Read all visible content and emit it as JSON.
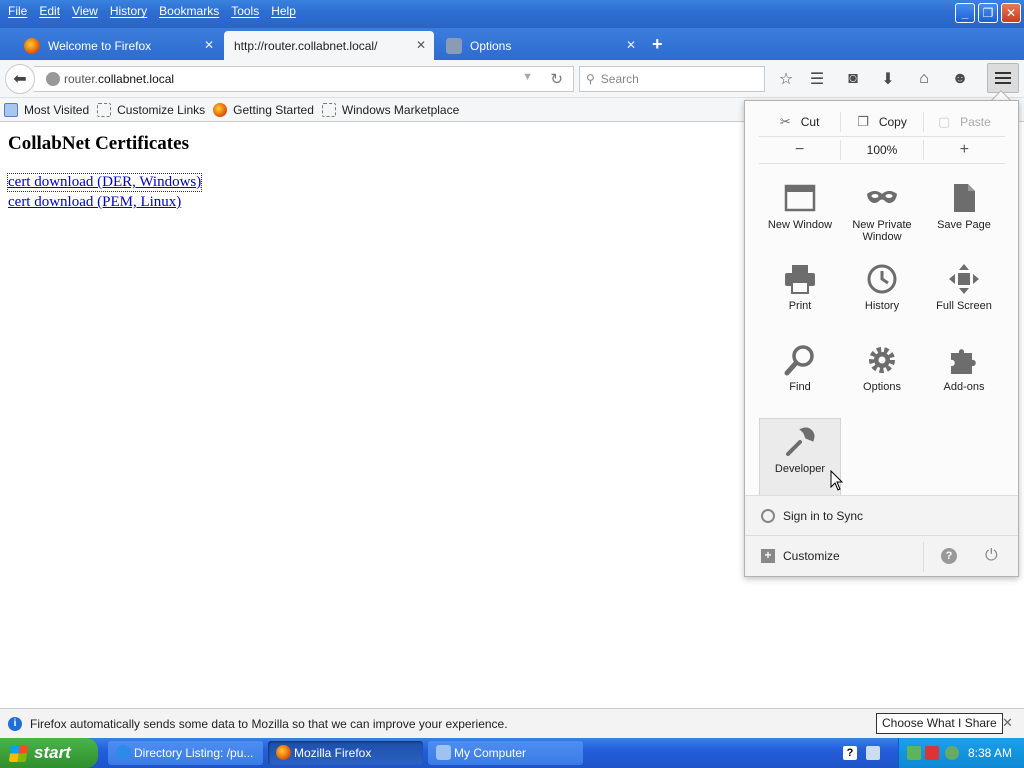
{
  "menubar": {
    "items": [
      "File",
      "Edit",
      "View",
      "History",
      "Bookmarks",
      "Tools",
      "Help"
    ]
  },
  "window_controls": {
    "minimize": "_",
    "maximize": "❐",
    "close": "✕"
  },
  "tabs": [
    {
      "title": "Welcome to Firefox",
      "icon": "firefox-icon",
      "active": false
    },
    {
      "title": "http://router.collabnet.local/",
      "icon": "none",
      "active": true
    },
    {
      "title": "Options",
      "icon": "gear-icon",
      "active": false
    }
  ],
  "tab_close_glyph": "✕",
  "new_tab_glyph": "+",
  "navbar": {
    "url_host_prefix": "router.",
    "url_host_main": "collabnet.local",
    "search_placeholder": "Search"
  },
  "bookmarks": {
    "items": [
      "Most Visited",
      "Customize Links",
      "Getting Started",
      "Windows Marketplace"
    ]
  },
  "page": {
    "title": "CollabNet Certificates",
    "links": [
      "cert download (DER, Windows)",
      "cert download (PEM, Linux)"
    ]
  },
  "panel": {
    "edit": {
      "cut": "Cut",
      "copy": "Copy",
      "paste": "Paste"
    },
    "zoom": {
      "minus": "−",
      "level": "100%",
      "plus": "+"
    },
    "items": [
      {
        "label": "New Window",
        "icon": "new-window-icon"
      },
      {
        "label": "New Private Window",
        "icon": "private-mask-icon"
      },
      {
        "label": "Save Page",
        "icon": "save-page-icon"
      },
      {
        "label": "Print",
        "icon": "printer-icon"
      },
      {
        "label": "History",
        "icon": "clock-icon"
      },
      {
        "label": "Full Screen",
        "icon": "fullscreen-icon"
      },
      {
        "label": "Find",
        "icon": "magnifier-icon"
      },
      {
        "label": "Options",
        "icon": "gear-icon"
      },
      {
        "label": "Add-ons",
        "icon": "puzzle-icon"
      },
      {
        "label": "Developer",
        "icon": "wrench-icon"
      }
    ],
    "sync": "Sign in to Sync",
    "customize": "Customize"
  },
  "notification": {
    "text": "Firefox automatically sends some data to Mozilla so that we can improve your experience.",
    "button": "Choose What I Share"
  },
  "taskbar": {
    "start": "start",
    "items": [
      "Directory Listing: /pu...",
      "Mozilla Firefox",
      "My Computer"
    ],
    "clock": "8:38 AM"
  },
  "colors": {
    "xp_blue": "#245edb",
    "link": "#0000c8",
    "start_green": "#2f8f2e"
  }
}
